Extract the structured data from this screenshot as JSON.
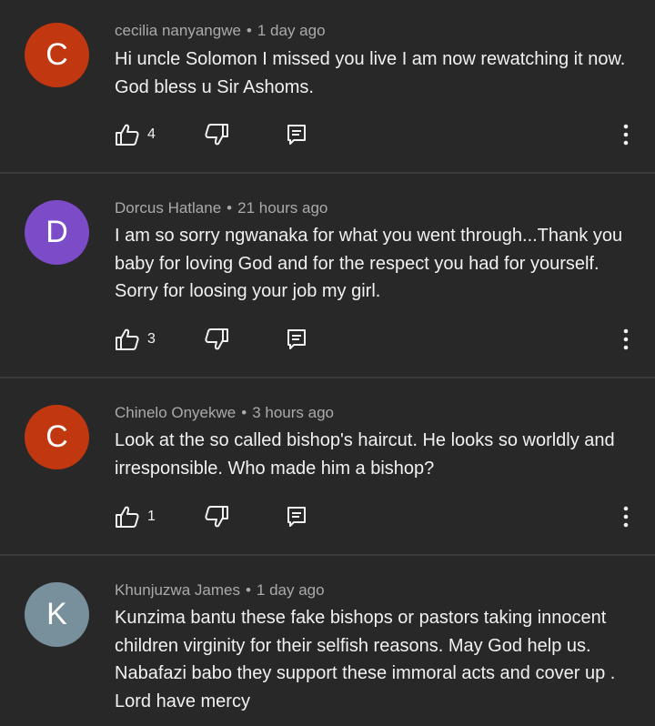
{
  "colors": {
    "background": "#282828",
    "divider": "#3b3b3b",
    "meta_text": "#aaaaaa",
    "body_text": "#f1f1f1"
  },
  "comments": [
    {
      "avatar_letter": "C",
      "avatar_color": "#c1370f",
      "author": "cecilia nanyangwe",
      "separator": "•",
      "time": "1 day ago",
      "text": "Hi uncle Solomon I missed you live  I am now rewatching it now. God bless u Sir Ashoms.",
      "likes": "4",
      "icons": [
        "thumbs-up-icon",
        "thumbs-down-icon",
        "reply-icon",
        "more-vert-icon"
      ]
    },
    {
      "avatar_letter": "D",
      "avatar_color": "#7c4cc8",
      "author": "Dorcus Hatlane",
      "separator": "•",
      "time": "21 hours ago",
      "text": "I am so sorry ngwanaka for what you went through...Thank you baby for  loving God and  for the respect you had for yourself. Sorry for loosing your job my girl.",
      "likes": "3",
      "icons": [
        "thumbs-up-icon",
        "thumbs-down-icon",
        "reply-icon",
        "more-vert-icon"
      ]
    },
    {
      "avatar_letter": "C",
      "avatar_color": "#c1370f",
      "author": "Chinelo Onyekwe",
      "separator": "•",
      "time": "3 hours ago",
      "text": "Look at the so called bishop's haircut. He looks so worldly and irresponsible. Who made him a bishop?",
      "likes": "1",
      "icons": [
        "thumbs-up-icon",
        "thumbs-down-icon",
        "reply-icon",
        "more-vert-icon"
      ]
    },
    {
      "avatar_letter": "K",
      "avatar_color": "#78909c",
      "author": "Khunjuzwa James",
      "separator": "•",
      "time": "1 day ago",
      "text": "Kunzima bantu these fake bishops or pastors taking innocent children virginity  for their selfish reasons. May God help us. Nabafazi babo they support these immoral acts and cover up . Lord have mercy"
    }
  ]
}
